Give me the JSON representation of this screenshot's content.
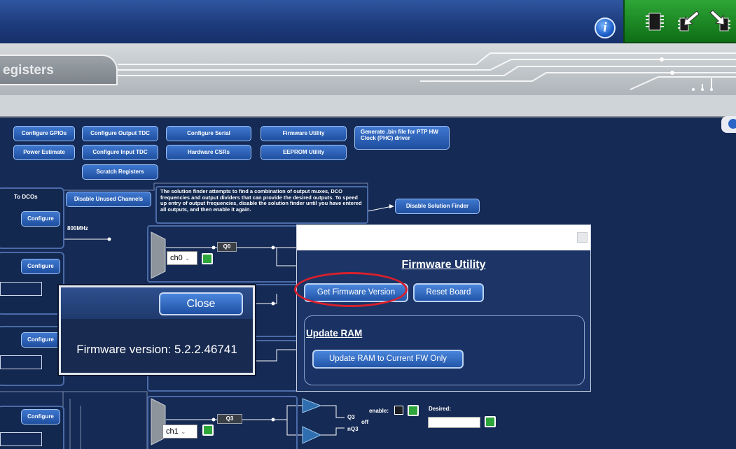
{
  "header": {
    "info_icon_label": "i",
    "toolbar_icons": [
      "chip-icon",
      "import-arrow-icon",
      "export-arrow-icon"
    ]
  },
  "tab": {
    "label": "egisters"
  },
  "buttons": {
    "configure_gpios": "Configure GPIOs",
    "power_estimate": "Power Estimate",
    "configure_output_tdc": "Configure Output TDC",
    "configure_input_tdc": "Configure Input TDC",
    "scratch_registers": "Scratch Registers",
    "configure_serial": "Configure Serial",
    "hardware_csrs": "Hardware CSRs",
    "firmware_utility": "Firmware Utility",
    "eeprom_utility": "EEPROM Utility",
    "generate_bin": "Generate .bin file for PTP HW Clock (PHC) driver",
    "disable_unused_channels": "Disable Unused Channels",
    "disable_solution_finder": "Disable Solution Finder",
    "configure": "Configure"
  },
  "diagram": {
    "to_dcos": "To DCOs",
    "freq": "800MHz",
    "solution_finder_note": "The solution finder attempts to find a combination of output muxes, DCO frequencies and output dividers that can provide the desired outputs. To speed up entry of output frequencies, disable the solution finder until you have entered all outputs, and then enable it again.",
    "ch0": "ch0",
    "ch1": "ch1",
    "q0": "Q0",
    "q3_box": "Q3",
    "q3_out": "Q3",
    "nq3_out": "nQ3",
    "off": "off",
    "enable": "enable:",
    "desired": "Desired:"
  },
  "firmware_dialog": {
    "title": "Firmware Utility",
    "get_version": "Get Firmware Version",
    "reset_board": "Reset Board",
    "update_ram_title": "Update RAM",
    "update_ram_button": "Update RAM to Current FW Only"
  },
  "version_popup": {
    "close": "Close",
    "text": "Firmware version: 5.2.2.46741"
  },
  "colors": {
    "background": "#152a55",
    "highlight": "#d8202c",
    "toolbox": "#1f8a27"
  }
}
